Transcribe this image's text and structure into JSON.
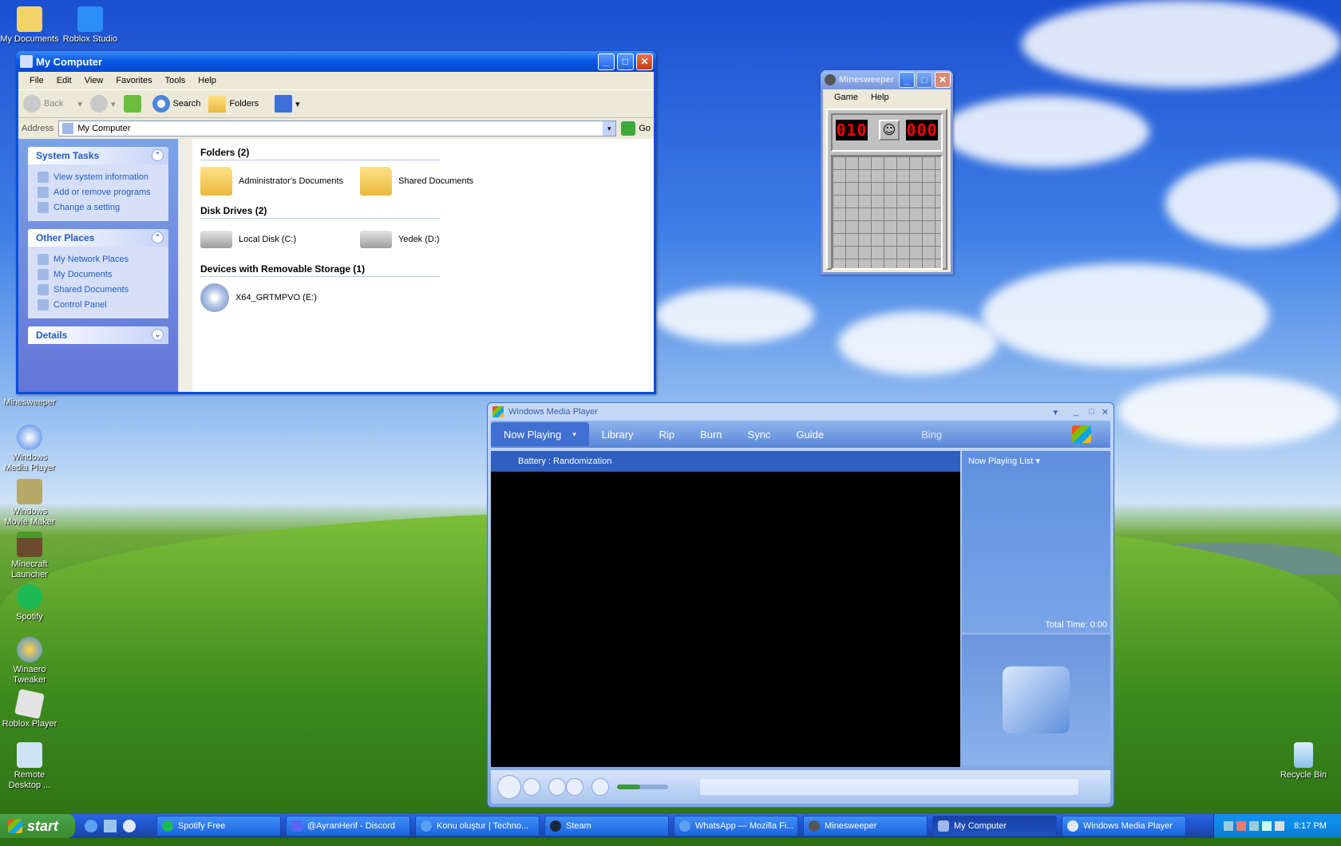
{
  "desktop": {
    "icons": [
      {
        "label": "My Documents",
        "icon": "my-documents-icon"
      },
      {
        "label": "Roblox Studio",
        "icon": "roblox-studio-icon"
      },
      {
        "label": "Minesweeper",
        "icon": "minesweeper-icon"
      },
      {
        "label": "Windows Media Player",
        "icon": "windows-media-player-icon"
      },
      {
        "label": "Windows Movie Maker",
        "icon": "movie-maker-icon"
      },
      {
        "label": "Minecraft Launcher",
        "icon": "minecraft-icon"
      },
      {
        "label": "Spotify",
        "icon": "spotify-icon"
      },
      {
        "label": "Winaero Tweaker",
        "icon": "winaero-icon"
      },
      {
        "label": "Roblox Player",
        "icon": "roblox-player-icon"
      },
      {
        "label": "Remote Desktop ...",
        "icon": "remote-desktop-icon"
      },
      {
        "label": "Recycle Bin",
        "icon": "recycle-bin-icon"
      }
    ]
  },
  "explorer": {
    "title": "My Computer",
    "menu": [
      "File",
      "Edit",
      "View",
      "Favorites",
      "Tools",
      "Help"
    ],
    "toolbar": {
      "back": "Back",
      "search": "Search",
      "folders": "Folders"
    },
    "address": {
      "label": "Address",
      "value": "My Computer",
      "go": "Go"
    },
    "system_tasks": {
      "title": "System Tasks",
      "items": [
        "View system information",
        "Add or remove programs",
        "Change a setting"
      ]
    },
    "other_places": {
      "title": "Other Places",
      "items": [
        "My Network Places",
        "My Documents",
        "Shared Documents",
        "Control Panel"
      ]
    },
    "details": {
      "title": "Details"
    },
    "groups": [
      {
        "title": "Folders (2)",
        "items": [
          "Administrator's Documents",
          "Shared Documents"
        ]
      },
      {
        "title": "Disk Drives (2)",
        "items": [
          "Local Disk (C:)",
          "Yedek (D:)"
        ]
      },
      {
        "title": "Devices with Removable Storage (1)",
        "items": [
          "X64_GRTMPVO (E:)"
        ]
      }
    ]
  },
  "minesweeper": {
    "title": "Minesweeper",
    "menu": [
      "Game",
      "Help"
    ],
    "mines_counter": "010",
    "timer": "000"
  },
  "wmp": {
    "title": "Windows Media Player",
    "tabs": [
      "Now Playing",
      "Library",
      "Rip",
      "Burn",
      "Sync",
      "Guide",
      "Bing"
    ],
    "visualization": "Battery : Randomization",
    "playlist_label": "Now Playing List",
    "total_time": "Total Time: 0:00",
    "volume": 0.45
  },
  "taskbar": {
    "start": "start",
    "tasks": [
      "Spotify Free",
      "@AyranHerif - Discord",
      "Konu oluştur | Techno...",
      "Steam",
      "WhatsApp — Mozilla Fi...",
      "Minesweeper",
      "My Computer",
      "Windows Media Player"
    ],
    "clock": "8:17 PM"
  }
}
